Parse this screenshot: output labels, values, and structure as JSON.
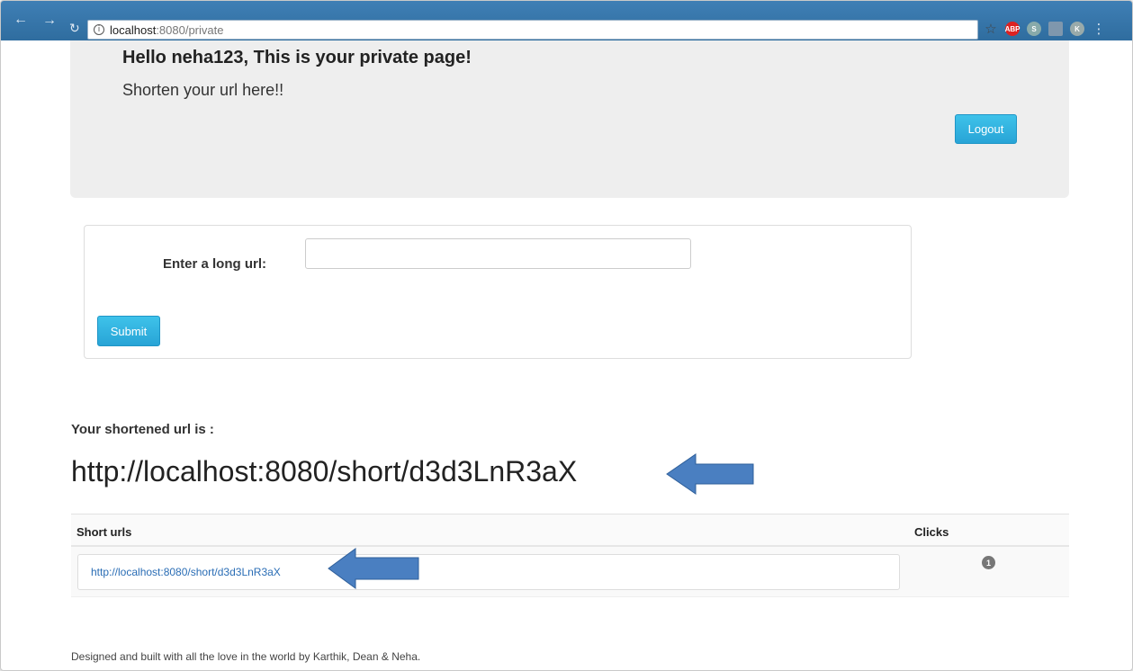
{
  "browser": {
    "url_host": "localhost",
    "url_rest": ":8080/private",
    "extensions": [
      "ABP",
      "S",
      "K"
    ]
  },
  "header": {
    "greeting": "Hello neha123, This is your private page!",
    "subtitle": "Shorten your url here!!",
    "logout_label": "Logout"
  },
  "form": {
    "label": "Enter a long url:",
    "input_value": "",
    "input_placeholder": "",
    "submit_label": "Submit"
  },
  "result": {
    "label": "Your shortened url is :",
    "short_url": "http://localhost:8080/short/d3d3LnR3aX"
  },
  "table": {
    "columns": [
      "Short urls",
      "Clicks"
    ],
    "rows": [
      {
        "short_url": "http://localhost:8080/short/d3d3LnR3aX",
        "clicks": "1"
      }
    ]
  },
  "footer": {
    "text": "Designed and built with all the love in the world by Karthik, Dean & Neha."
  },
  "colors": {
    "button": "#28a4d6",
    "jumbotron": "#eeeeee",
    "link": "#2a6db5",
    "arrow": "#4a7fc1"
  }
}
